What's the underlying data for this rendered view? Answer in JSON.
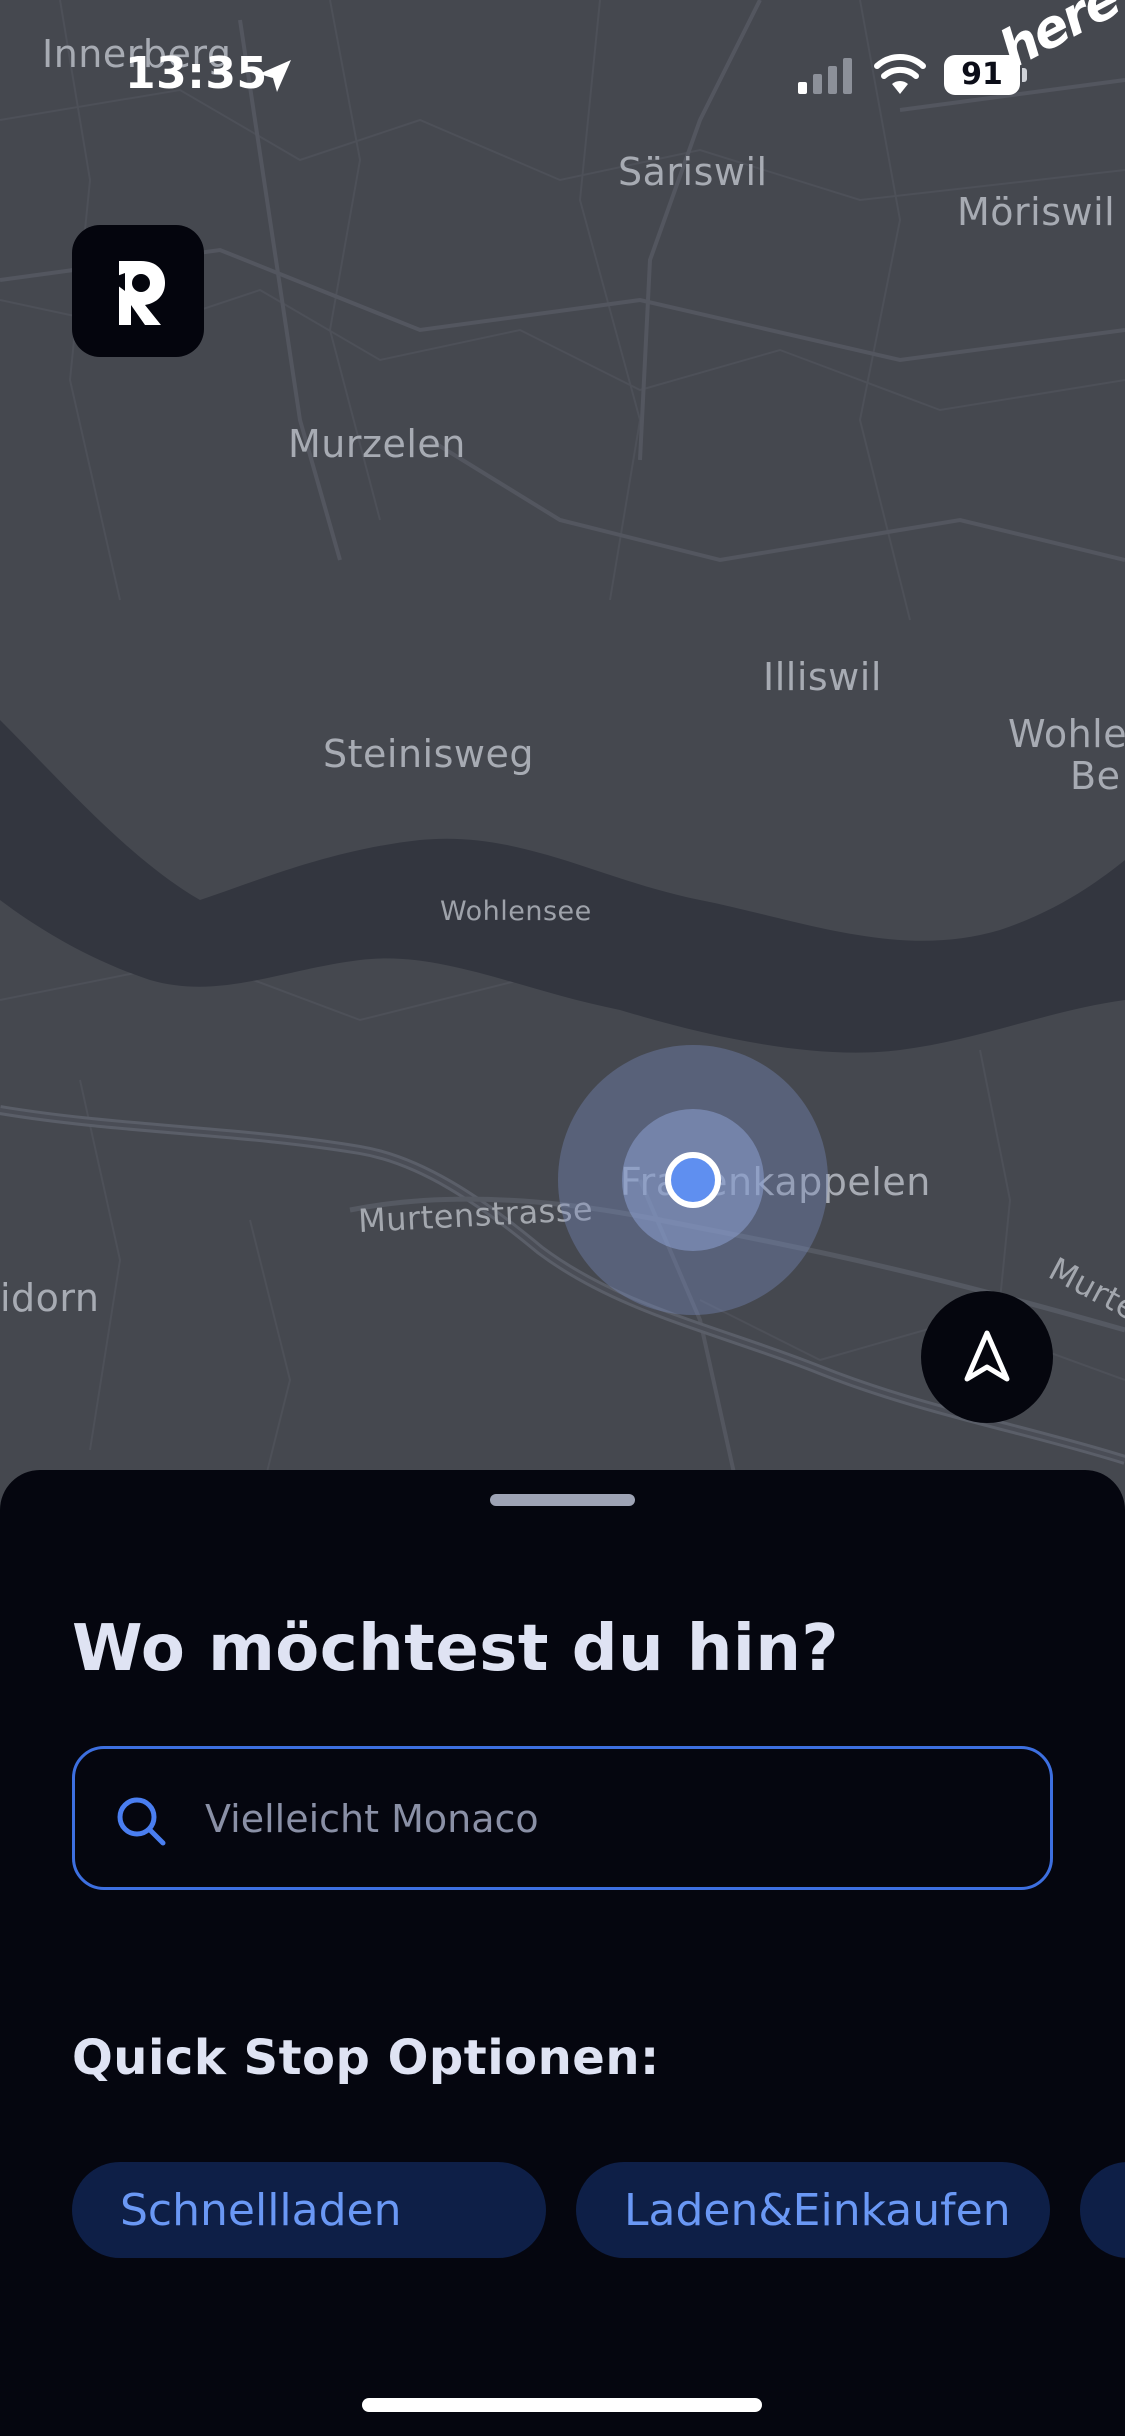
{
  "status_bar": {
    "time": "13:35",
    "battery": "91",
    "map_brand": "here"
  },
  "map": {
    "places": {
      "innerberg": "Innerberg",
      "saeriswil": "Säriswil",
      "moeriswil": "Möriswil",
      "murzelen": "Murzelen",
      "illiswil": "Illiswil",
      "wohlen": "Wohle",
      "bern": "Be",
      "steinisweg": "Steinisweg",
      "wohlensee": "Wohlensee",
      "frauenkappelen": "Frauenkappelen",
      "murtenstrasse": "Murtenstrasse",
      "ried_horn": "idorn",
      "murten_right": "Murte"
    },
    "colors": {
      "land": "#45484f",
      "water": "#33363f",
      "road": "#555962",
      "location": "#5f8ff0"
    }
  },
  "sheet": {
    "title": "Wo möchtest du hin?",
    "search": {
      "placeholder": "Vielleicht Monaco",
      "value": ""
    },
    "quick_stop_title": "Quick Stop Optionen:",
    "chips": [
      {
        "label": "Schnellladen"
      },
      {
        "label": "Laden&Einkaufen"
      },
      {
        "label": ""
      }
    ],
    "colors": {
      "background": "#05060f",
      "accent": "#3d6fe0",
      "chip_bg": "#0e1f47",
      "chip_text": "#6a98f5"
    }
  }
}
